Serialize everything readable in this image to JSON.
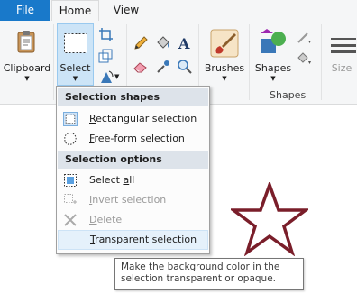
{
  "tabs": {
    "file": "File",
    "home": "Home",
    "view": "View"
  },
  "ribbon": {
    "clipboard_label": "Clipboard",
    "select_label": "Select",
    "brushes_label": "Brushes",
    "shapes_label": "Shapes",
    "shapes_group_label": "Shapes",
    "size_label": "Size"
  },
  "menu": {
    "header_shapes": "Selection shapes",
    "rect_pre": "",
    "rect_key": "R",
    "rect_post": "ectangular selection",
    "free_pre": "",
    "free_key": "F",
    "free_post": "ree-form selection",
    "header_options": "Selection options",
    "select_all_pre": "Select ",
    "select_all_key": "a",
    "select_all_post": "ll",
    "invert_pre": "",
    "invert_key": "I",
    "invert_post": "nvert selection",
    "delete_pre": "",
    "delete_key": "D",
    "delete_post": "elete",
    "transparent_pre": "",
    "transparent_key": "T",
    "transparent_post": "ransparent selection"
  },
  "tooltip": {
    "line1": "Make the background color in the",
    "line2": "selection transparent or opaque."
  },
  "colors": {
    "file_tab": "#1979ca",
    "star_outline": "#7a1e2a",
    "hover": "#e5f1fb"
  }
}
